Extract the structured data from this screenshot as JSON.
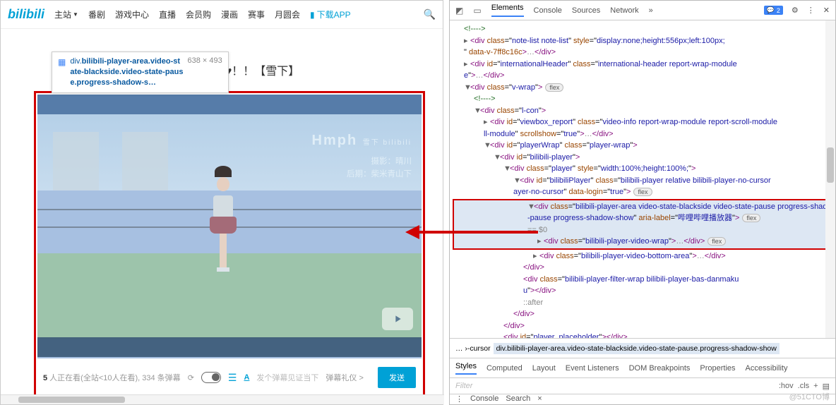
{
  "nav": {
    "logo": "bilibili",
    "main": "主站",
    "items": [
      "番剧",
      "游戏中心",
      "直播",
      "会员购",
      "漫画",
      "赛事",
      "月圆会"
    ],
    "download": "下载APP"
  },
  "tooltip": {
    "prefix": "div.",
    "line1": "bilibili-player-area.video-st",
    "line2": "ate-blackside.video-state-paus",
    "line3": "e.progress-shadow-s…",
    "dims": "638 × 493"
  },
  "title_visible": "ph♥！！【雪下】",
  "video": {
    "overlay_title": "Hmph",
    "wm_suffix": "雪下 bilibili",
    "credit1": "摄影：晴川",
    "credit2": "后期：柴米青山下"
  },
  "danmaku": {
    "count_bold": "5",
    "stat_text": " 人正在看(全站<10人在看), 334 条弹幕",
    "placeholder": "发个弹幕见证当下",
    "rites": "弹幕礼仪 >",
    "send": "发送"
  },
  "devtools": {
    "tabs": [
      "Elements",
      "Console",
      "Sources",
      "Network"
    ],
    "more": "»",
    "errcount": "2",
    "tree": {
      "l1": "<!---->",
      "l2a": "note-list note-list",
      "l2s": "display:none;height:556px;left:100px;",
      "l2d": "data-v-7ff8c16c",
      "l3id": "internationalHeader",
      "l3cl": "international-header report-wrap-module",
      "l4": "v-wrap",
      "l5": "<!---->",
      "l6": "l-con",
      "l7id": "viewbox_report",
      "l7cl": "video-info report-wrap-module report-scroll-module",
      "l7a": "scrollshow",
      "l7v": "true",
      "l8id": "playerWrap",
      "l8cl": "player-wrap",
      "l9id": "bilibili-player",
      "l10cl": "player",
      "l10s": "width:100%;height:100%;",
      "l11id": "bilibiliPlayer",
      "l11cl": "bilibili-player relative bilibili-player-no-cursor",
      "l11a": "data-login",
      "l11v": "true",
      "hl_cl": "bilibili-player-area video-state-blackside video-state-pause progress-shadow-show",
      "hl_a": "aria-label",
      "hl_v": "哔哩哔哩播放器",
      "hl_sel": "== $0",
      "l12cl": "bilibili-player-video-wrap",
      "l13cl": "bilibili-player-video-bottom-area",
      "l14cl": "bilibili-player-filter-wrap bilibili-player-bas-danmaku",
      "l15": "::after",
      "l16id": "player_placeholder"
    },
    "crumb_pre": "… ›-cursor",
    "crumb_sel": "div.bilibili-player-area.video-state-blackside.video-state-pause.progress-shadow-show",
    "styles_tabs": [
      "Styles",
      "Computed",
      "Layout",
      "Event Listeners",
      "DOM Breakpoints",
      "Properties",
      "Accessibility"
    ],
    "filter": "Filter",
    "fr1": ":hov",
    "fr2": ".cls",
    "fr3": "+",
    "drawer": [
      "Console",
      "Search"
    ],
    "watermark": "@51CTO博"
  }
}
